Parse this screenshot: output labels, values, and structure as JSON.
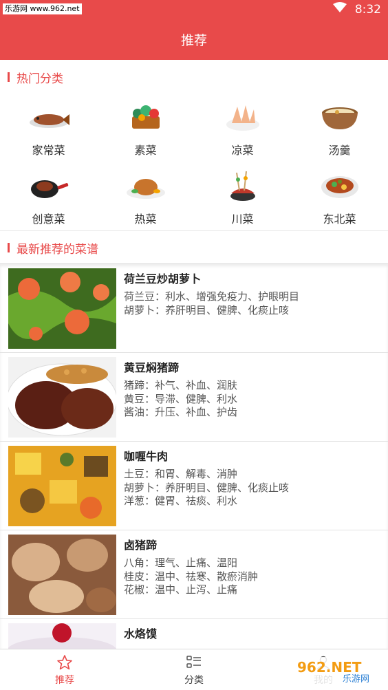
{
  "status_bar": {
    "watermark": "乐游网 www.962.net",
    "time": "8:32"
  },
  "header": {
    "title": "推荐"
  },
  "hot_categories": {
    "title": "热门分类",
    "items": [
      {
        "label": "家常菜",
        "icon": "fish-dish-icon"
      },
      {
        "label": "素菜",
        "icon": "vegetable-basket-icon"
      },
      {
        "label": "凉菜",
        "icon": "cold-dish-icon"
      },
      {
        "label": "汤羹",
        "icon": "soup-pot-icon"
      },
      {
        "label": "创意菜",
        "icon": "frying-pan-icon"
      },
      {
        "label": "热菜",
        "icon": "roast-chicken-icon"
      },
      {
        "label": "川菜",
        "icon": "skewer-pot-icon"
      },
      {
        "label": "东北菜",
        "icon": "stir-fry-plate-icon"
      }
    ]
  },
  "latest": {
    "title": "最新推荐的菜谱",
    "recipes": [
      {
        "name": "荷兰豆炒胡萝卜",
        "lines": [
          "荷兰豆：利水、增强免疫力、护眼明目",
          "胡萝卜：养肝明目、健脾、化痰止咳"
        ]
      },
      {
        "name": "黄豆焖猪蹄",
        "lines": [
          "猪蹄：补气、补血、润肤",
          "黄豆：导滞、健脾、利水",
          "酱油：升压、补血、护齿"
        ]
      },
      {
        "name": "咖喱牛肉",
        "lines": [
          "土豆：和胃、解毒、消肿",
          "胡萝卜：养肝明目、健脾、化痰止咳",
          "洋葱：健胃、祛痰、利水"
        ]
      },
      {
        "name": "卤猪蹄",
        "lines": [
          "八角：理气、止痛、温阳",
          "桂皮：温中、祛寒、散瘀消肿",
          "花椒：温中、止泻、止痛"
        ]
      },
      {
        "name": "水烙馍",
        "lines": []
      }
    ]
  },
  "tabs": [
    {
      "label": "推荐",
      "icon": "star-icon",
      "active": true
    },
    {
      "label": "分类",
      "icon": "list-icon",
      "active": false
    },
    {
      "label": "我的",
      "icon": "user-icon",
      "active": false
    }
  ],
  "brand_logo": {
    "text": "962.NET",
    "subtext": "乐游网"
  },
  "colors": {
    "accent": "#e84a4a"
  }
}
